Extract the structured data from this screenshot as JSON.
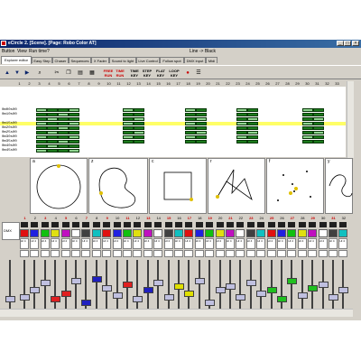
{
  "window": {
    "title": "eCircle 2. [Scene]. [Page: Robo Color AT]",
    "controls": [
      "_",
      "□",
      "×"
    ]
  },
  "menubar": {
    "items": [
      "Button",
      "View",
      "Run time",
      "?"
    ],
    "right_text": "Line -> Black"
  },
  "tabs": [
    {
      "label": "Explorer editor",
      "active": true
    },
    {
      "label": "Easy Step",
      "active": false
    },
    {
      "label": "Chaser",
      "active": false
    },
    {
      "label": "Sequences",
      "active": false
    },
    {
      "label": "X Fader",
      "active": false
    },
    {
      "label": "Sound to light",
      "active": false
    },
    {
      "label": "Live Control",
      "active": false
    },
    {
      "label": "Follow spot",
      "active": false
    },
    {
      "label": "DMX input",
      "active": false
    },
    {
      "label": "Midi",
      "active": false
    }
  ],
  "toolbar": {
    "icons": [
      "arrow-up-icon",
      "arrow-down-icon",
      "play-icon",
      "magnifier-icon",
      "cut-icon",
      "copy-icon",
      "paste-icon",
      "grid-icon",
      "record-icon",
      "list-icon"
    ],
    "labels": [
      "FREE RUN",
      "TIME RUN",
      "TIME KEY",
      "STEP KEY",
      "FLAT KEY",
      "LOOP KEY"
    ]
  },
  "grid": {
    "columns": [
      "1",
      "2",
      "3",
      "4",
      "5",
      "6",
      "7",
      "8",
      "9",
      "10",
      "11",
      "12",
      "13",
      "14",
      "15",
      "16",
      "17",
      "18",
      "19",
      "20",
      "21",
      "22",
      "23",
      "24",
      "25",
      "26",
      "27",
      "28",
      "29",
      "30",
      "31",
      "32",
      "33"
    ],
    "rows": [
      "0m00s00",
      "0m10s00",
      "0m15s00",
      "0m20s00",
      "0m25s00",
      "0m30s00",
      "0m35s00",
      "0m40s00",
      "0m45s00"
    ],
    "highlight_row": "0m15s00"
  },
  "shapes": [
    {
      "label": "a",
      "kind": "circle"
    },
    {
      "label": "z",
      "kind": "blob"
    },
    {
      "label": "c",
      "kind": "square"
    },
    {
      "label": "r",
      "kind": "zigzag"
    },
    {
      "label": "f",
      "kind": "dots"
    },
    {
      "label": "y",
      "kind": "curve"
    }
  ],
  "mixer": {
    "channels": [
      "1",
      "2",
      "3",
      "4",
      "5",
      "6",
      "7",
      "8",
      "9",
      "10",
      "11",
      "12",
      "13",
      "14",
      "15",
      "16",
      "17",
      "18",
      "19",
      "20",
      "21",
      "22",
      "23",
      "24",
      "25",
      "26",
      "27",
      "28",
      "29",
      "30",
      "31",
      "32"
    ],
    "master_label": "DMX",
    "status_text": "HI 4",
    "colors": [
      "#e01010",
      "#2020e0",
      "#10c010",
      "#e0e010",
      "#c010c0",
      "#ffffff",
      "#404040",
      "#10c0c0"
    ]
  }
}
